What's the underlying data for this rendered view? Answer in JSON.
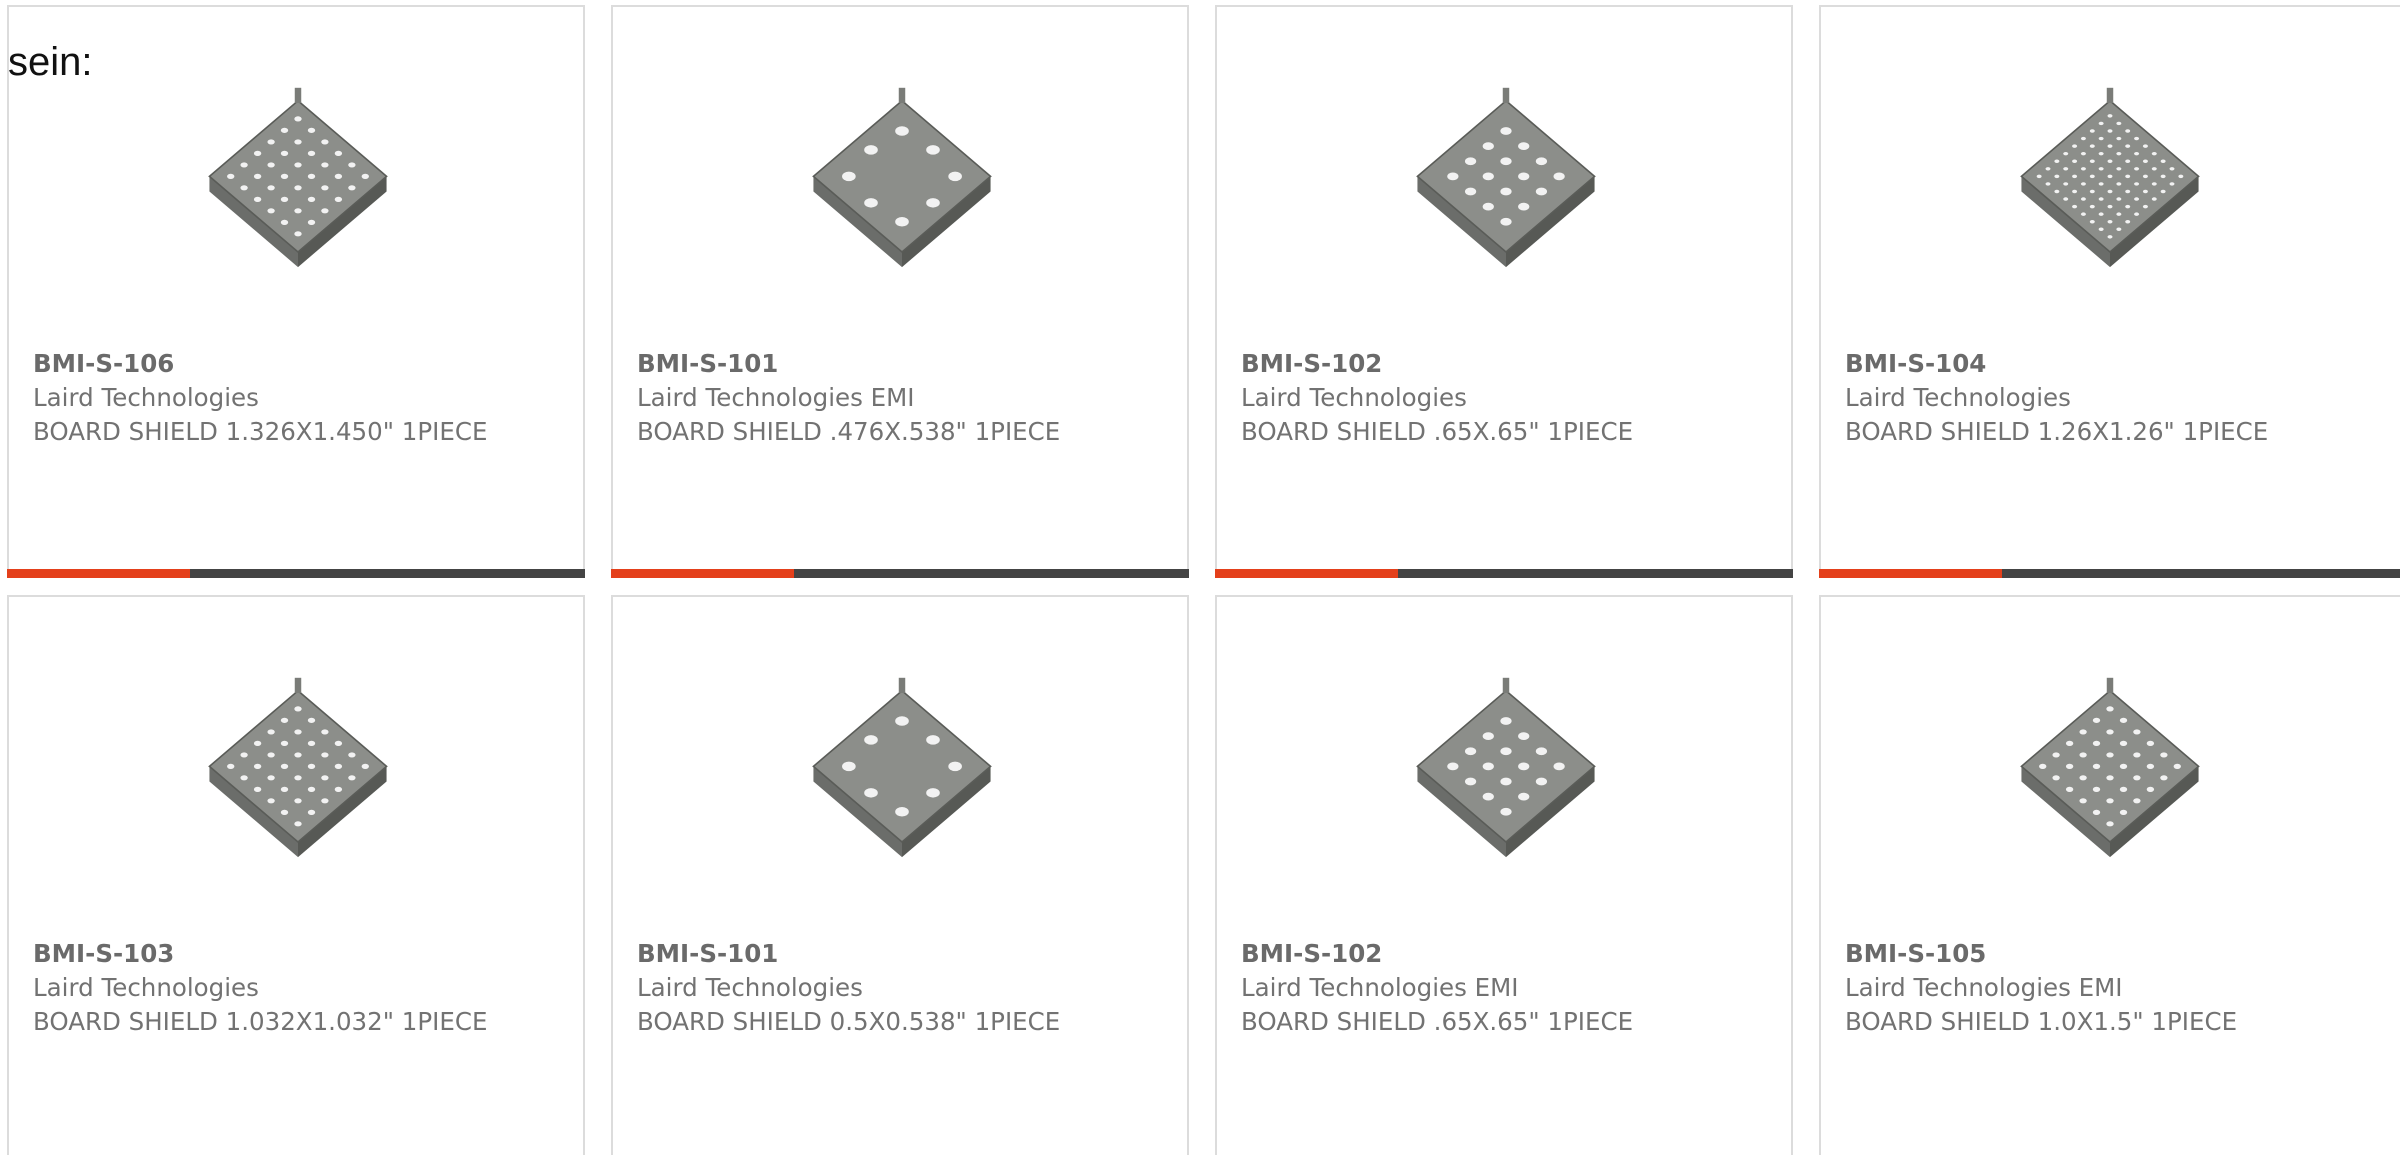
{
  "lead_text": "sein:",
  "cards": [
    {
      "part": "BMI-S-106",
      "maker": "Laird Technologies",
      "desc": "BOARD SHIELD 1.326X1.450\" 1PIECE",
      "holes": "dense"
    },
    {
      "part": "BMI-S-101",
      "maker": "Laird Technologies EMI",
      "desc": "BOARD SHIELD .476X.538\" 1PIECE",
      "holes": "ring"
    },
    {
      "part": "BMI-S-102",
      "maker": "Laird Technologies",
      "desc": "BOARD SHIELD .65X.65\" 1PIECE",
      "holes": "grid"
    },
    {
      "part": "BMI-S-104",
      "maker": "Laird Technologies",
      "desc": "BOARD SHIELD 1.26X1.26\" 1PIECE",
      "holes": "fine"
    },
    {
      "part": "BMI-S-103",
      "maker": "Laird Technologies",
      "desc": "BOARD SHIELD 1.032X1.032\" 1PIECE",
      "holes": "dense"
    },
    {
      "part": "BMI-S-101",
      "maker": "Laird Technologies",
      "desc": "BOARD SHIELD 0.5X0.538\" 1PIECE",
      "holes": "ring"
    },
    {
      "part": "BMI-S-102",
      "maker": "Laird Technologies EMI",
      "desc": "BOARD SHIELD .65X.65\" 1PIECE",
      "holes": "grid"
    },
    {
      "part": "BMI-S-105",
      "maker": "Laird Technologies EMI",
      "desc": "BOARD SHIELD 1.0X1.5\" 1PIECE",
      "holes": "dense"
    }
  ],
  "colors": {
    "accent": "#e4401b",
    "bar": "#444444",
    "border": "#dcdcdc",
    "text": "#727272"
  }
}
